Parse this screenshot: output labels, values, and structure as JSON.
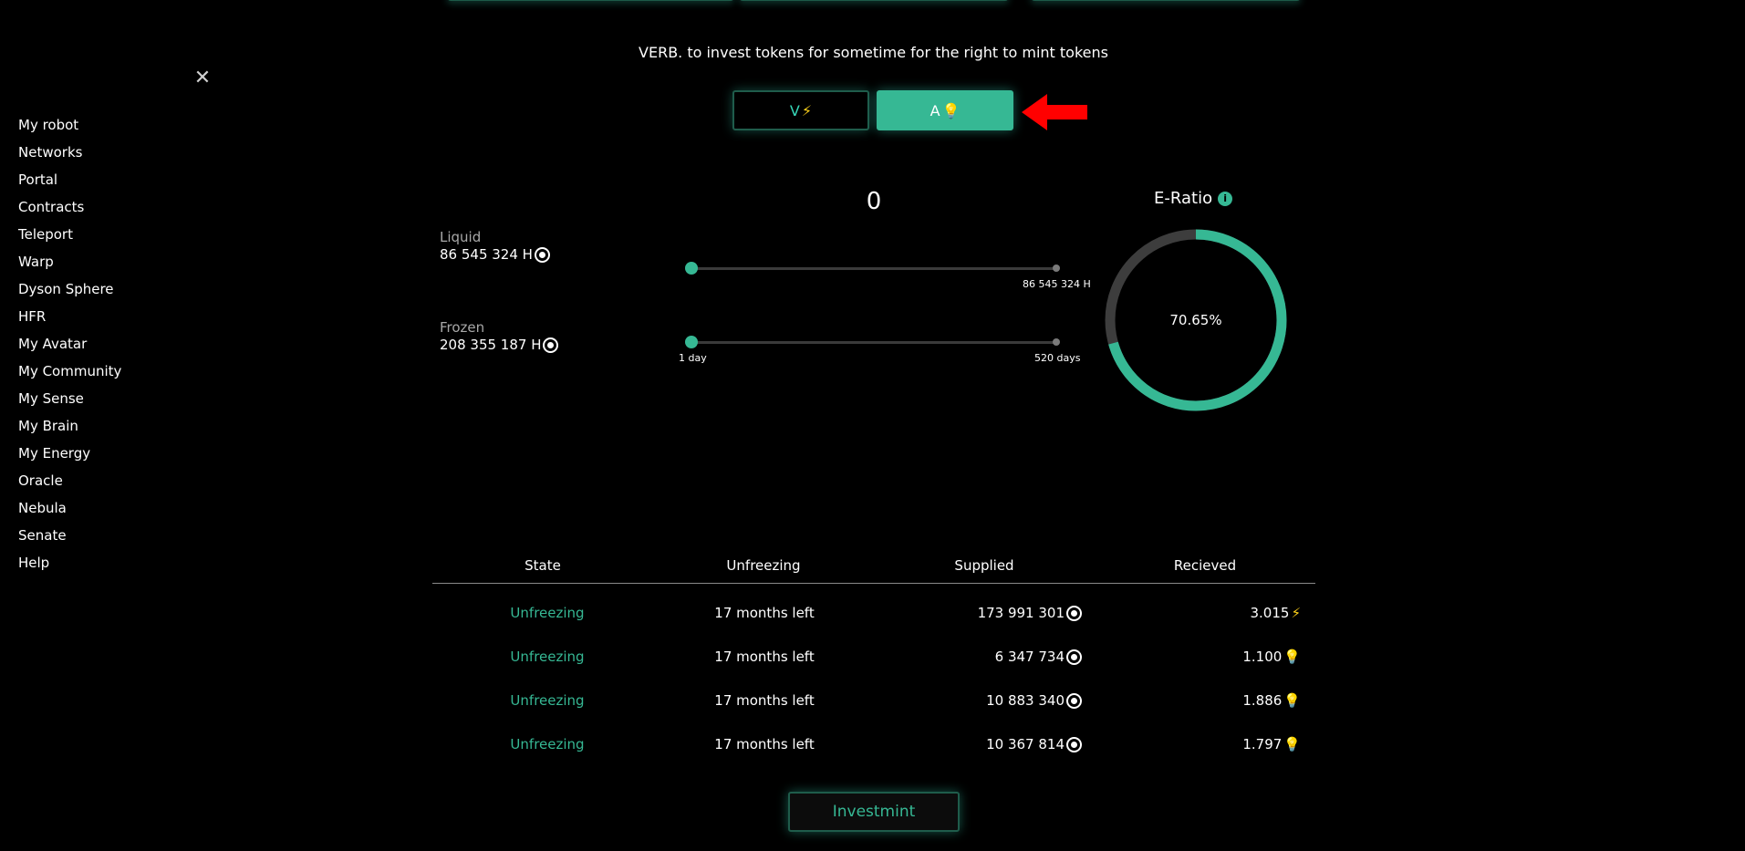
{
  "heading": "VERB. to invest tokens for sometime for the right to mint tokens",
  "tabs": [
    {
      "label": "V",
      "icon": "lightning-icon",
      "glyph": "⚡"
    },
    {
      "label": "A",
      "icon": "lightbulb-icon",
      "glyph": "💡"
    }
  ],
  "amount": "0",
  "liquid": {
    "label": "Liquid",
    "value": "86 545 324 H"
  },
  "frozen": {
    "label": "Frozen",
    "value": "208 355 187 H"
  },
  "amount_slider": {
    "max_label": "86 545 324 H",
    "position": 0
  },
  "period_slider": {
    "min_label": "1 day",
    "max_label": "520 days",
    "position": 0
  },
  "ratio": {
    "title": "E-Ratio",
    "info_glyph": "i",
    "value": "70.65%",
    "fraction": 0.7065
  },
  "sidebar": {
    "close_glyph": "✕",
    "items": [
      "My robot",
      "Networks",
      "Portal",
      "Contracts",
      "Teleport",
      "Warp",
      "Dyson Sphere",
      "HFR",
      "My Avatar",
      "My Community",
      "My Sense",
      "My Brain",
      "My Energy",
      "Oracle",
      "Nebula",
      "Senate",
      "Help"
    ]
  },
  "table": {
    "headers": [
      "State",
      "Unfreezing",
      "Supplied",
      "Recieved"
    ],
    "rows": [
      {
        "state": "Unfreezing",
        "unfreezing": "17 months left",
        "supplied": "173 991 301",
        "received": "3.015",
        "received_icon": "lightning-icon",
        "received_glyph": "⚡"
      },
      {
        "state": "Unfreezing",
        "unfreezing": "17 months left",
        "supplied": "6 347 734",
        "received": "1.100",
        "received_icon": "lightbulb-icon",
        "received_glyph": "💡"
      },
      {
        "state": "Unfreezing",
        "unfreezing": "17 months left",
        "supplied": "10 883 340",
        "received": "1.886",
        "received_icon": "lightbulb-icon",
        "received_glyph": "💡"
      },
      {
        "state": "Unfreezing",
        "unfreezing": "17 months left",
        "supplied": "10 367 814",
        "received": "1.797",
        "received_icon": "lightbulb-icon",
        "received_glyph": "💡"
      }
    ]
  },
  "action_button": "Investmint",
  "colors": {
    "accent": "#36b894",
    "background": "#000000",
    "annotation_arrow": "#ff0000"
  }
}
